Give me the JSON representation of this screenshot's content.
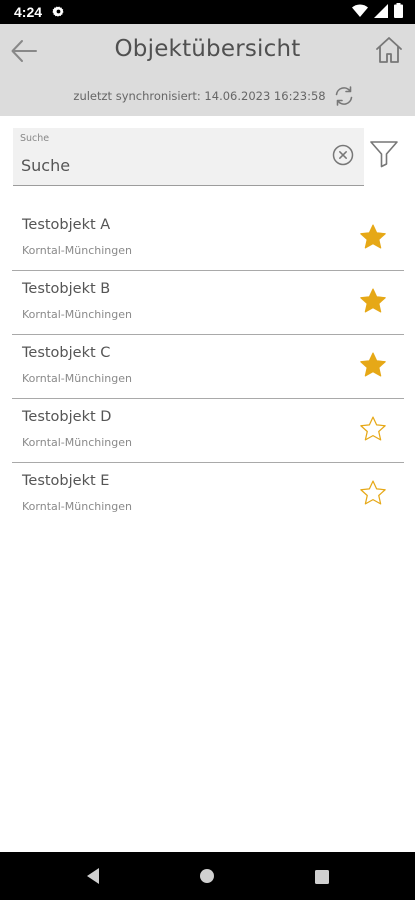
{
  "status_bar": {
    "time": "4:24",
    "icons": [
      "gear-icon",
      "wifi-icon",
      "cellular-signal-icon",
      "battery-icon"
    ]
  },
  "header": {
    "title": "Objektübersicht",
    "sync_text": "zuletzt synchronisiert: 14.06.2023 16:23:58",
    "icons": [
      "back-arrow-icon",
      "home-icon",
      "sync-icon"
    ],
    "background_color": "#dcdcdc"
  },
  "search": {
    "label": "Suche",
    "placeholder": "Suche",
    "value": "",
    "icons": [
      "clear-icon",
      "filter-icon"
    ]
  },
  "objects": [
    {
      "title": "Testobjekt A",
      "subtitle": "Korntal-Münchingen",
      "favorite": true
    },
    {
      "title": "Testobjekt B",
      "subtitle": "Korntal-Münchingen",
      "favorite": true
    },
    {
      "title": "Testobjekt C",
      "subtitle": "Korntal-Münchingen",
      "favorite": true
    },
    {
      "title": "Testobjekt D",
      "subtitle": "Korntal-Münchingen",
      "favorite": false
    },
    {
      "title": "Testobjekt E",
      "subtitle": "Korntal-Münchingen",
      "favorite": false
    }
  ],
  "colors": {
    "star": "#e6a817",
    "status_bar": "#000000",
    "nav_bar": "#000000"
  },
  "nav_bar": {
    "icons": [
      "nav-back-icon",
      "nav-home-icon",
      "nav-recents-icon"
    ]
  }
}
